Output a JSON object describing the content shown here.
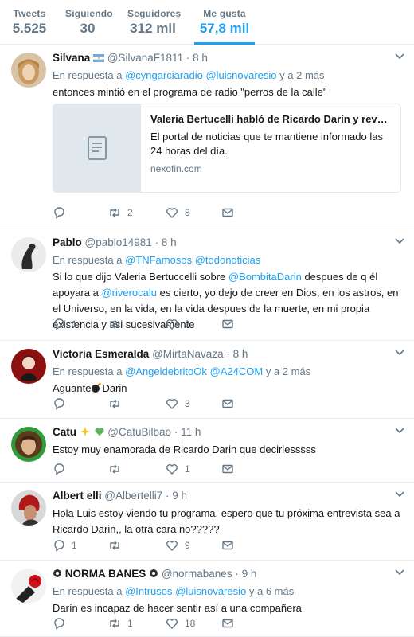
{
  "stats": [
    {
      "label": "Tweets",
      "value": "5.525",
      "active": false
    },
    {
      "label": "Siguiendo",
      "value": "30",
      "active": false
    },
    {
      "label": "Seguidores",
      "value": "312 mil",
      "active": false
    },
    {
      "label": "Me gusta",
      "value": "57,8 mil",
      "active": true
    }
  ],
  "colors": {
    "accent": "#1da1f2",
    "muted": "#657786",
    "text": "#14171a"
  },
  "tweets": [
    {
      "name": "Silvana",
      "handle": "@SilvanaF1811",
      "time": "8 h",
      "reply_prefix": "En respuesta a",
      "reply_mentions": [
        "@cyngarciaradio",
        "@luisnovaresio"
      ],
      "reply_suffix": "y a 2 más",
      "text": "entonces mintió en el programa de radio \"perros de la calle\"",
      "card": {
        "title": "Valeria Bertucelli habló de Ricardo Darín y reveló p...",
        "description": "El portal de noticias que te mantiene informado las 24 horas del día.",
        "domain": "nexofin.com"
      },
      "replies": "",
      "retweets": "2",
      "likes": "8"
    },
    {
      "name": "Pablo",
      "handle": "@pablo14981",
      "time": "8 h",
      "reply_prefix": "En respuesta a",
      "reply_mentions": [
        "@TNFamosos",
        "@todonoticias"
      ],
      "reply_suffix": "",
      "text_parts": {
        "p1": "Si lo que dijo Valeria Bertuccelli sobre ",
        "m1": "@BombitaDarin",
        "p2": " despues de q él apoyara a ",
        "m2": "@riverocalu",
        "p3": " es cierto, yo dejo de creer en Dios, en los astros, en el Universo, en la vida, en la vida despues de la muerte, en mi propia existencia y asi sucesivamente"
      },
      "replies": "1",
      "retweets": "",
      "likes": "3"
    },
    {
      "name": "Victoria Esmeralda",
      "handle": "@MirtaNavaza",
      "time": "8 h",
      "reply_prefix": "En respuesta a",
      "reply_mentions": [
        "@AngeldebritoOk",
        "@A24COM"
      ],
      "reply_suffix": "y a 2 más",
      "text_a": "Aguante",
      "text_b": "Darin",
      "replies": "",
      "retweets": "",
      "likes": "3"
    },
    {
      "name": "Catu",
      "handle": "@CatuBilbao",
      "time": "11 h",
      "text": "Estoy muy enamorada de Ricardo Darin que decirlesssss",
      "replies": "",
      "retweets": "",
      "likes": "1"
    },
    {
      "name": "Albert elli",
      "handle": "@Albertelli7",
      "time": "9 h",
      "text": "Hola Luis estoy viendo tu programa, espero que tu próxima entrevista sea a Ricardo Darin,, la otra cara no?????",
      "replies": "1",
      "retweets": "",
      "likes": "9"
    },
    {
      "name": "NORMA BANES",
      "handle": "@normabanes",
      "time": "9 h",
      "reply_prefix": "En respuesta a",
      "reply_mentions": [
        "@Intrusos",
        "@luisnovaresio"
      ],
      "reply_suffix": "y a 6 más",
      "text": "Darín es incapaz de hacer sentir así a una compañera",
      "replies": "",
      "retweets": "1",
      "likes": "18"
    }
  ],
  "time_sep": "·"
}
